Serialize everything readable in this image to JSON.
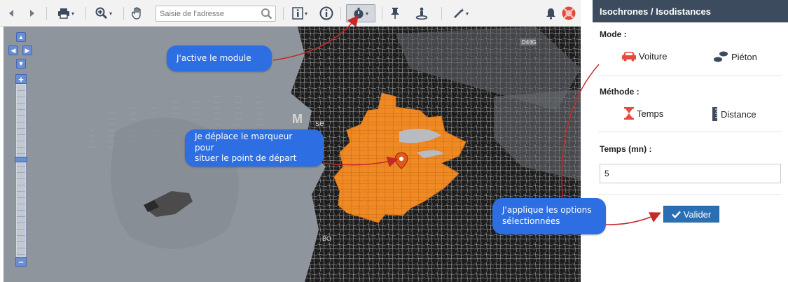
{
  "toolbar": {
    "search_placeholder": "Saisie de l'adresse"
  },
  "map": {
    "label_road": "D44G",
    "label_town": "M",
    "label_town2": "se",
    "label_bo": "BO"
  },
  "callouts": {
    "c1": "J'active le module",
    "c2_line1": "Je déplace le marqueur pour",
    "c2_line2": "situer le point de départ",
    "c3_line1": "J'applique les options",
    "c3_line2": "sélectionnées"
  },
  "panel": {
    "title": "Isochrones / Isodistances",
    "mode_label": "Mode :",
    "mode_options": [
      {
        "label": "Voiture",
        "icon": "car-icon"
      },
      {
        "label": "Piéton",
        "icon": "footsteps-icon"
      }
    ],
    "methode_label": "Méthode :",
    "methode_options": [
      {
        "label": "Temps",
        "icon": "hourglass-icon"
      },
      {
        "label": "Distance",
        "icon": "ruler-icon"
      }
    ],
    "temps_label": "Temps (mn) :",
    "temps_value": "5",
    "submit_label": "Valider"
  },
  "colors": {
    "panel_header": "#3c4b5d",
    "isochrone": "#f08a24",
    "callout": "#2d6fe2",
    "submit": "#2b6fb3",
    "annotation_arrow": "#c62828"
  }
}
